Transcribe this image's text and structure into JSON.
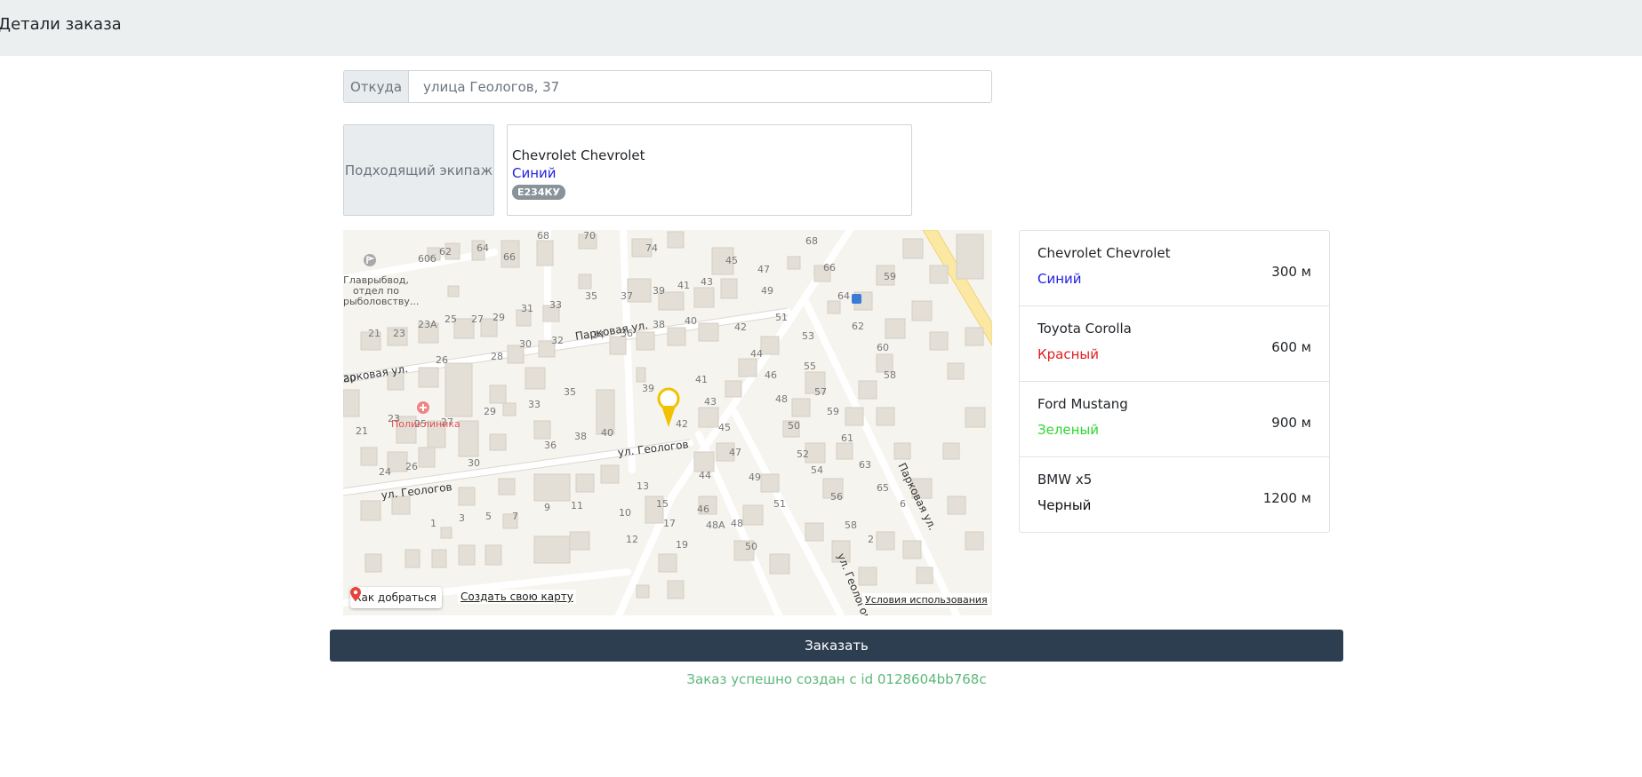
{
  "header": {
    "title": "Детали заказа"
  },
  "from": {
    "label": "Откуда",
    "value": "улица Геологов, 37"
  },
  "crew": {
    "label": "Подходящий экипаж",
    "car": "Chevrolet Chevrolet",
    "color": "Синий",
    "plate": "Е234КУ"
  },
  "map": {
    "route_button": "Как добраться",
    "create_map_link": "Создать свою карту",
    "terms_link": "Условия использования",
    "poi": {
      "fish": "Главрыбвод, отдел по рыболовству...",
      "fish_line1": "Главрыбвод,",
      "fish_line2": "отдел по",
      "fish_line3": "рыболовству...",
      "clinic": "Поликлиника"
    },
    "streets": {
      "parkovaya_1": "Парковая ул.",
      "parkovaya_2": "Парковая ул.",
      "parkovaya_3": "Парковая ул.",
      "geologov_1": "ул. Геологов",
      "geologov_2": "ул. Геологов",
      "geologov_3": "ул. Геологов"
    }
  },
  "crews_list": [
    {
      "name": "Chevrolet Chevrolet",
      "color": "Синий",
      "color_hex": "#1f1fe0",
      "distance": "300 м"
    },
    {
      "name": "Toyota Corolla",
      "color": "Красный",
      "color_hex": "#e01f1f",
      "distance": "600 м"
    },
    {
      "name": "Ford Mustang",
      "color": "Зеленый",
      "color_hex": "#2ed82e",
      "distance": "900 м"
    },
    {
      "name": "BMW x5",
      "color": "Черный",
      "color_hex": "#111111",
      "distance": "1200 м"
    }
  ],
  "order_button": "Заказать",
  "status_message": "Заказ успешно создан с id 0128604bb768c",
  "colors": {
    "header_bg": "#eceff0",
    "button_bg": "#2c3e50",
    "success": "#5cb87a"
  }
}
